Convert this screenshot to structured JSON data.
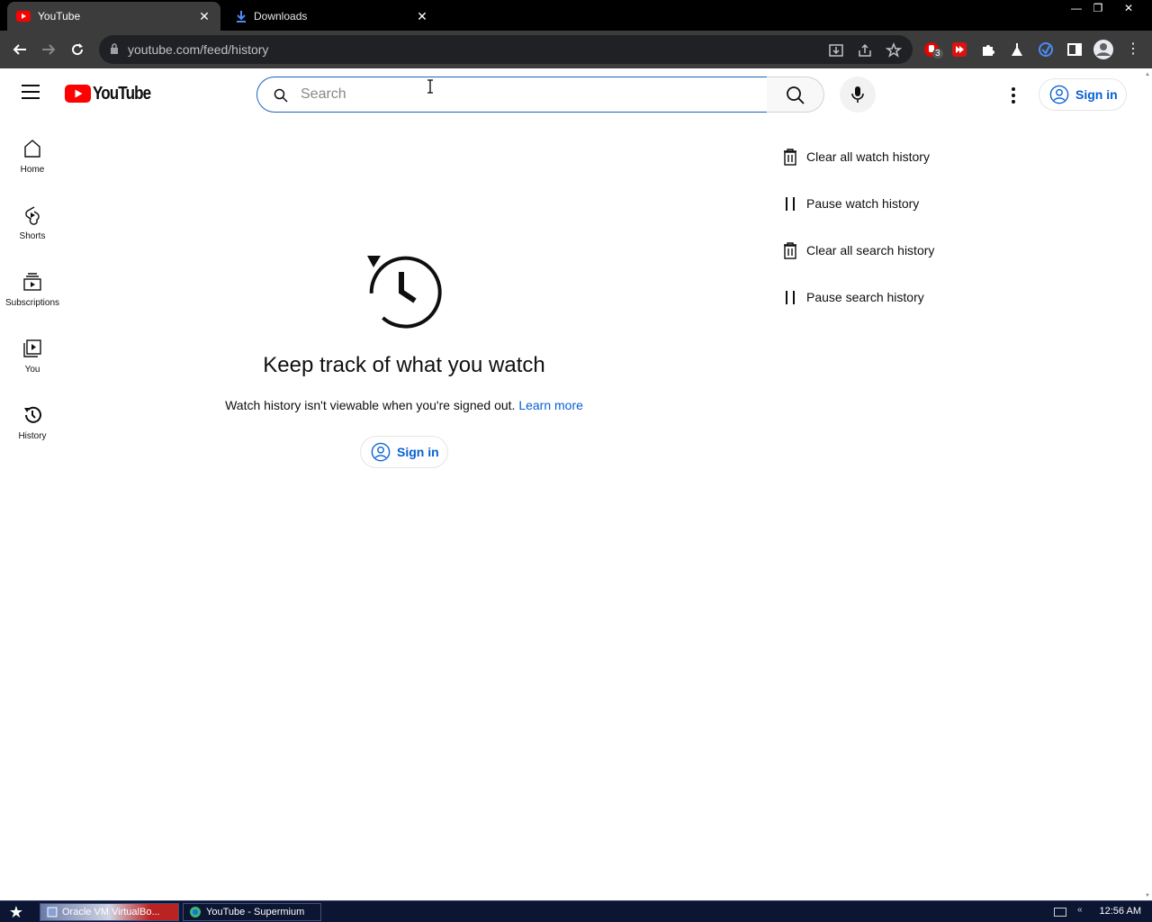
{
  "browser": {
    "tabs": [
      {
        "title": "YouTube",
        "icon": "youtube-favicon",
        "active": true
      },
      {
        "title": "Downloads",
        "icon": "download-icon",
        "active": false
      }
    ],
    "url": "youtube.com/feed/history",
    "extension_badge": "3"
  },
  "header": {
    "logo_text": "YouTube",
    "search_placeholder": "Search",
    "signin_label": "Sign in"
  },
  "sidebar": {
    "items": [
      {
        "label": "Home",
        "icon": "home-icon"
      },
      {
        "label": "Shorts",
        "icon": "shorts-icon"
      },
      {
        "label": "Subscriptions",
        "icon": "subscriptions-icon"
      },
      {
        "label": "You",
        "icon": "you-icon"
      },
      {
        "label": "History",
        "icon": "history-icon"
      }
    ]
  },
  "main": {
    "title": "Keep track of what you watch",
    "description": "Watch history isn't viewable when you're signed out.",
    "learn_more": "Learn more",
    "signin_label": "Sign in"
  },
  "actions": [
    {
      "label": "Clear all watch history",
      "icon": "trash-icon"
    },
    {
      "label": "Pause watch history",
      "icon": "pause-icon"
    },
    {
      "label": "Clear all search history",
      "icon": "trash-icon"
    },
    {
      "label": "Pause search history",
      "icon": "pause-icon"
    }
  ],
  "taskbar": {
    "items": [
      {
        "label": "Oracle VM VirtualBo..."
      },
      {
        "label": "YouTube - Supermium"
      }
    ],
    "clock": "12:56 AM"
  },
  "colors": {
    "accent_blue": "#065fd4",
    "youtube_red": "#ff0000",
    "chrome_dark": "#3c3c3c"
  }
}
